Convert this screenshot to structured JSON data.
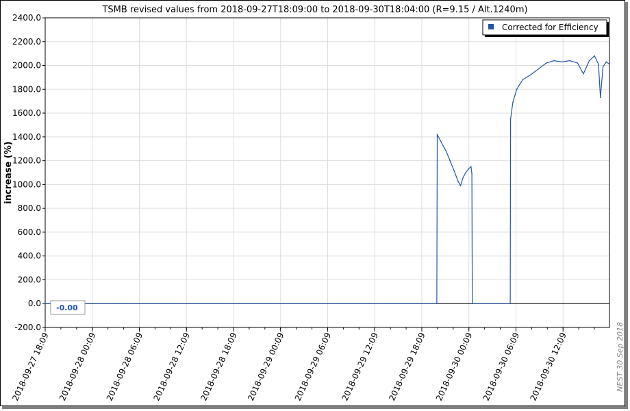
{
  "chart_data": {
    "type": "line",
    "title": "TSMB revised values from 2018-09-27T18:09:00 to 2018-09-30T18:04:00 (R=9.15 / Alt.1240m)",
    "xlabel": "",
    "ylabel": "increase (%)",
    "ylim": [
      -200,
      2400
    ],
    "xlim": [
      "2018-09-27 18:09",
      "2018-09-30 18:04"
    ],
    "y_ticks": [
      "2400.0",
      "2200.0",
      "2000.0",
      "1800.0",
      "1600.0",
      "1400.0",
      "1200.0",
      "1000.0",
      "800.0",
      "600.0",
      "400.0",
      "200.0",
      "0.0",
      "-200.0"
    ],
    "y_tick_values": [
      2400,
      2200,
      2000,
      1800,
      1600,
      1400,
      1200,
      1000,
      800,
      600,
      400,
      200,
      0,
      -200
    ],
    "x_ticks": [
      "2018-09-27 18:09",
      "2018-09-28 00:09",
      "2018-09-28 06:09",
      "2018-09-28 12:09",
      "2018-09-28 18:09",
      "2018-09-29 00:09",
      "2018-09-29 06:09",
      "2018-09-29 12:09",
      "2018-09-29 18:09",
      "2018-09-30 00:09",
      "2018-09-30 06:09",
      "2018-09-30 12:09"
    ],
    "x_tick_hours": [
      0,
      6,
      12,
      18,
      24,
      30,
      36,
      42,
      48,
      54,
      60,
      66
    ],
    "grid": true,
    "legend": "top-right",
    "series": [
      {
        "name": "Corrected for Efficiency",
        "color": "#2255aa",
        "points": [
          [
            "2018-09-27 18:09",
            0
          ],
          [
            "2018-09-29 20:04",
            0
          ],
          [
            "2018-09-29 20:07",
            1420
          ],
          [
            "2018-09-29 20:40",
            1350
          ],
          [
            "2018-09-29 21:15",
            1280
          ],
          [
            "2018-09-29 21:45",
            1200
          ],
          [
            "2018-09-29 22:15",
            1120
          ],
          [
            "2018-09-29 22:45",
            1030
          ],
          [
            "2018-09-29 23:05",
            990
          ],
          [
            "2018-09-29 23:25",
            1060
          ],
          [
            "2018-09-29 23:45",
            1100
          ],
          [
            "2018-09-30 00:05",
            1130
          ],
          [
            "2018-09-30 00:25",
            1150
          ],
          [
            "2018-09-30 00:32",
            1090
          ],
          [
            "2018-09-30 00:35",
            0
          ],
          [
            "2018-09-30 05:25",
            0
          ],
          [
            "2018-09-30 05:28",
            1550
          ],
          [
            "2018-09-30 05:45",
            1690
          ],
          [
            "2018-09-30 06:15",
            1800
          ],
          [
            "2018-09-30 07:00",
            1880
          ],
          [
            "2018-09-30 08:00",
            1920
          ],
          [
            "2018-09-30 09:00",
            1970
          ],
          [
            "2018-09-30 10:00",
            2020
          ],
          [
            "2018-09-30 11:00",
            2040
          ],
          [
            "2018-09-30 12:00",
            2030
          ],
          [
            "2018-09-30 13:00",
            2040
          ],
          [
            "2018-09-30 14:00",
            2020
          ],
          [
            "2018-09-30 14:45",
            1930
          ],
          [
            "2018-09-30 15:30",
            2040
          ],
          [
            "2018-09-30 16:10",
            2080
          ],
          [
            "2018-09-30 16:40",
            2010
          ],
          [
            "2018-09-30 16:55",
            1730
          ],
          [
            "2018-09-30 17:15",
            1990
          ],
          [
            "2018-09-30 17:40",
            2030
          ],
          [
            "2018-09-30 18:04",
            2010
          ]
        ]
      }
    ],
    "value_box": "-0.00",
    "side_note": "NEST  30 Sep 2018"
  }
}
